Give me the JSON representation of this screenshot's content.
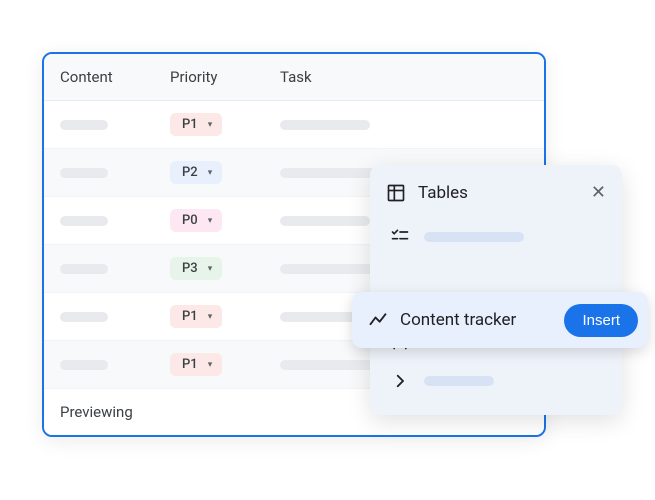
{
  "table": {
    "headers": {
      "content": "Content",
      "priority": "Priority",
      "task": "Task"
    },
    "rows": [
      {
        "priority": "P1",
        "chipClass": "pc-p1",
        "taskLen": "ph-med"
      },
      {
        "priority": "P2",
        "chipClass": "pc-p2",
        "taskLen": "ph-long"
      },
      {
        "priority": "P0",
        "chipClass": "pc-p0",
        "taskLen": "ph-med"
      },
      {
        "priority": "P3",
        "chipClass": "pc-p3",
        "taskLen": "ph-long"
      },
      {
        "priority": "P1",
        "chipClass": "pc-p1",
        "taskLen": "ph-med"
      },
      {
        "priority": "P1",
        "chipClass": "pc-p1",
        "taskLen": "ph-long"
      }
    ],
    "footer": "Previewing"
  },
  "popup": {
    "title": "Tables",
    "highlight": {
      "label": "Content tracker",
      "button": "Insert"
    }
  }
}
